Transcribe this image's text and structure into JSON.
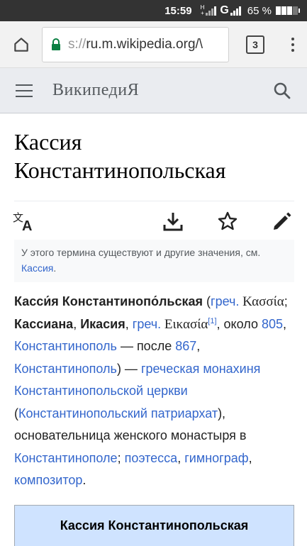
{
  "status_bar": {
    "time": "15:59",
    "net_top": "H",
    "net_bottom": "+",
    "network": "G",
    "battery": "65 %"
  },
  "browser": {
    "url_scheme": "s://",
    "url_host": "ru.m.wikipedia.org/\\",
    "tab_count": "3"
  },
  "wiki_header": {
    "wordmark": "ВикипедиЯ"
  },
  "article": {
    "title": "Кассия Константинопольская",
    "hatnote": {
      "text": "У этого термина существуют и другие значения, см. ",
      "link": "Кассия",
      "end": "."
    },
    "p": {
      "name1": "Касси́я Константинопо́льская",
      "t1": " (",
      "l_grech1": "греч.",
      "g1": " Κασσία",
      "t2": "; ",
      "name2": "Кассиана",
      "t3": ", ",
      "name3": "Икасия",
      "t4": ", ",
      "l_grech2": "греч.",
      "g2": " Εικασία",
      "ref": "[1]",
      "t5": ", около ",
      "l_805": "805",
      "t6": ", ",
      "l_const1": "Константинополь",
      "t7": " — после ",
      "l_867": "867",
      "t8": ", ",
      "l_const2": "Константинополь",
      "t9": ") — ",
      "l_nun": "греческая монахиня Константинопольской церкви",
      "t10": " (",
      "l_patr": "Константинопольский патриархат",
      "t11": "), основательница женского монастыря в ",
      "l_const3": "Константинополе",
      "t12": "; ",
      "l_poet": "поэтесса",
      "t13": ", ",
      "l_hymn": "гимнограф",
      "t14": ", ",
      "l_comp": "композитор",
      "t15": "."
    },
    "infobox_title": "Кассия Константинопольская"
  }
}
